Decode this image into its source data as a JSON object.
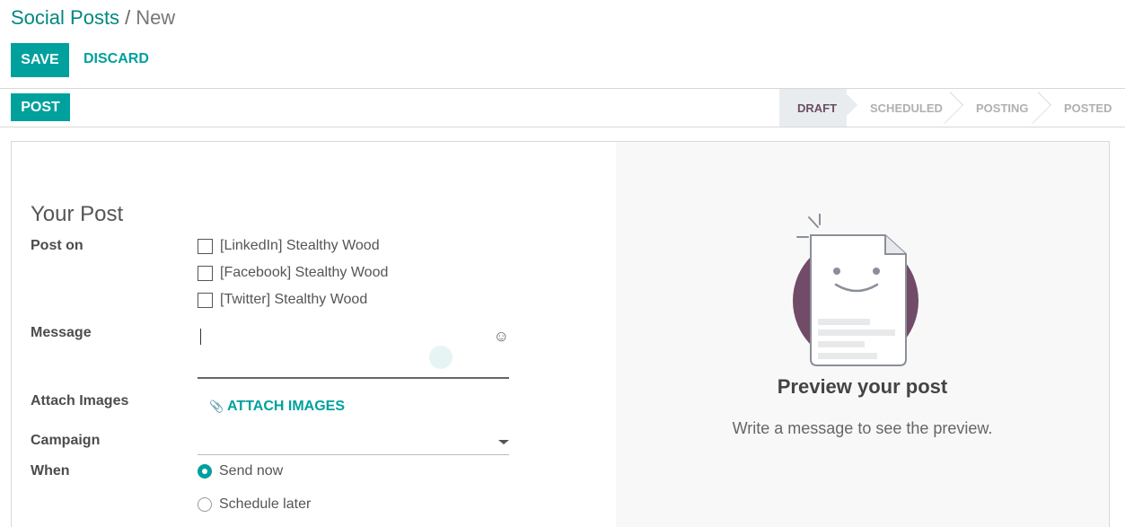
{
  "breadcrumb": {
    "parent": "Social Posts",
    "separator": "/",
    "current": "New"
  },
  "toolbar": {
    "save_label": "SAVE",
    "discard_label": "DISCARD"
  },
  "statusbar": {
    "post_label": "POST",
    "stages": [
      {
        "label": "DRAFT",
        "active": true
      },
      {
        "label": "SCHEDULED",
        "active": false
      },
      {
        "label": "POSTING",
        "active": false
      },
      {
        "label": "POSTED",
        "active": false
      }
    ]
  },
  "form": {
    "section_title": "Your Post",
    "post_on_label": "Post on",
    "accounts": [
      {
        "label": "[LinkedIn] Stealthy Wood",
        "checked": false
      },
      {
        "label": "[Facebook] Stealthy Wood",
        "checked": false
      },
      {
        "label": "[Twitter] Stealthy Wood",
        "checked": false
      }
    ],
    "message_label": "Message",
    "message_value": "",
    "emoji_icon": "☺",
    "attach_label": "Attach Images",
    "attach_button": "ATTACH IMAGES",
    "attach_icon": "📎",
    "campaign_label": "Campaign",
    "campaign_value": "",
    "when_label": "When",
    "when_options": [
      {
        "label": "Send now",
        "selected": true
      },
      {
        "label": "Schedule later",
        "selected": false
      }
    ]
  },
  "preview": {
    "title": "Preview your post",
    "subtitle": "Write a message to see the preview."
  },
  "colors": {
    "accent": "#00a09d",
    "brand": "#6c4e65",
    "link": "#00877f"
  }
}
